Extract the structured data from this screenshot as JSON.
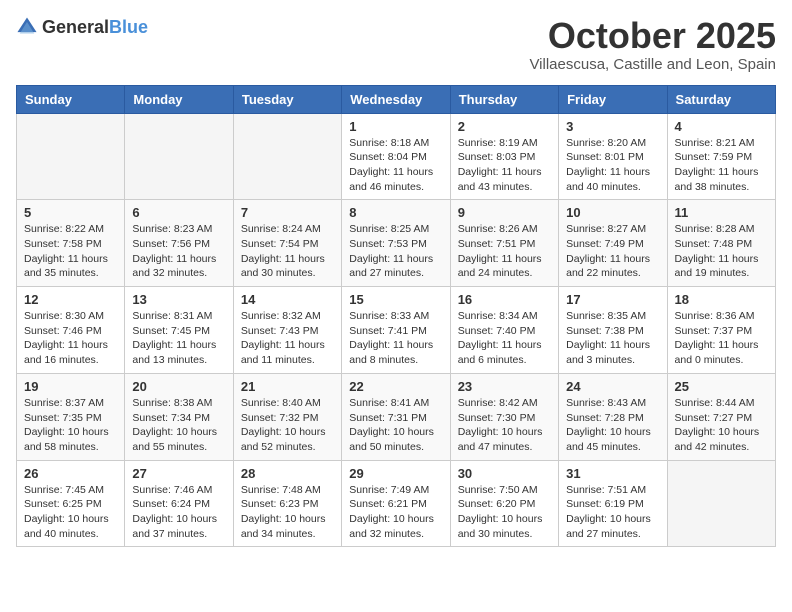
{
  "logo": {
    "general": "General",
    "blue": "Blue"
  },
  "header": {
    "month": "October 2025",
    "location": "Villaescusa, Castille and Leon, Spain"
  },
  "weekdays": [
    "Sunday",
    "Monday",
    "Tuesday",
    "Wednesday",
    "Thursday",
    "Friday",
    "Saturday"
  ],
  "weeks": [
    [
      {
        "day": "",
        "info": ""
      },
      {
        "day": "",
        "info": ""
      },
      {
        "day": "",
        "info": ""
      },
      {
        "day": "1",
        "info": "Sunrise: 8:18 AM\nSunset: 8:04 PM\nDaylight: 11 hours\nand 46 minutes."
      },
      {
        "day": "2",
        "info": "Sunrise: 8:19 AM\nSunset: 8:03 PM\nDaylight: 11 hours\nand 43 minutes."
      },
      {
        "day": "3",
        "info": "Sunrise: 8:20 AM\nSunset: 8:01 PM\nDaylight: 11 hours\nand 40 minutes."
      },
      {
        "day": "4",
        "info": "Sunrise: 8:21 AM\nSunset: 7:59 PM\nDaylight: 11 hours\nand 38 minutes."
      }
    ],
    [
      {
        "day": "5",
        "info": "Sunrise: 8:22 AM\nSunset: 7:58 PM\nDaylight: 11 hours\nand 35 minutes."
      },
      {
        "day": "6",
        "info": "Sunrise: 8:23 AM\nSunset: 7:56 PM\nDaylight: 11 hours\nand 32 minutes."
      },
      {
        "day": "7",
        "info": "Sunrise: 8:24 AM\nSunset: 7:54 PM\nDaylight: 11 hours\nand 30 minutes."
      },
      {
        "day": "8",
        "info": "Sunrise: 8:25 AM\nSunset: 7:53 PM\nDaylight: 11 hours\nand 27 minutes."
      },
      {
        "day": "9",
        "info": "Sunrise: 8:26 AM\nSunset: 7:51 PM\nDaylight: 11 hours\nand 24 minutes."
      },
      {
        "day": "10",
        "info": "Sunrise: 8:27 AM\nSunset: 7:49 PM\nDaylight: 11 hours\nand 22 minutes."
      },
      {
        "day": "11",
        "info": "Sunrise: 8:28 AM\nSunset: 7:48 PM\nDaylight: 11 hours\nand 19 minutes."
      }
    ],
    [
      {
        "day": "12",
        "info": "Sunrise: 8:30 AM\nSunset: 7:46 PM\nDaylight: 11 hours\nand 16 minutes."
      },
      {
        "day": "13",
        "info": "Sunrise: 8:31 AM\nSunset: 7:45 PM\nDaylight: 11 hours\nand 13 minutes."
      },
      {
        "day": "14",
        "info": "Sunrise: 8:32 AM\nSunset: 7:43 PM\nDaylight: 11 hours\nand 11 minutes."
      },
      {
        "day": "15",
        "info": "Sunrise: 8:33 AM\nSunset: 7:41 PM\nDaylight: 11 hours\nand 8 minutes."
      },
      {
        "day": "16",
        "info": "Sunrise: 8:34 AM\nSunset: 7:40 PM\nDaylight: 11 hours\nand 6 minutes."
      },
      {
        "day": "17",
        "info": "Sunrise: 8:35 AM\nSunset: 7:38 PM\nDaylight: 11 hours\nand 3 minutes."
      },
      {
        "day": "18",
        "info": "Sunrise: 8:36 AM\nSunset: 7:37 PM\nDaylight: 11 hours\nand 0 minutes."
      }
    ],
    [
      {
        "day": "19",
        "info": "Sunrise: 8:37 AM\nSunset: 7:35 PM\nDaylight: 10 hours\nand 58 minutes."
      },
      {
        "day": "20",
        "info": "Sunrise: 8:38 AM\nSunset: 7:34 PM\nDaylight: 10 hours\nand 55 minutes."
      },
      {
        "day": "21",
        "info": "Sunrise: 8:40 AM\nSunset: 7:32 PM\nDaylight: 10 hours\nand 52 minutes."
      },
      {
        "day": "22",
        "info": "Sunrise: 8:41 AM\nSunset: 7:31 PM\nDaylight: 10 hours\nand 50 minutes."
      },
      {
        "day": "23",
        "info": "Sunrise: 8:42 AM\nSunset: 7:30 PM\nDaylight: 10 hours\nand 47 minutes."
      },
      {
        "day": "24",
        "info": "Sunrise: 8:43 AM\nSunset: 7:28 PM\nDaylight: 10 hours\nand 45 minutes."
      },
      {
        "day": "25",
        "info": "Sunrise: 8:44 AM\nSunset: 7:27 PM\nDaylight: 10 hours\nand 42 minutes."
      }
    ],
    [
      {
        "day": "26",
        "info": "Sunrise: 7:45 AM\nSunset: 6:25 PM\nDaylight: 10 hours\nand 40 minutes."
      },
      {
        "day": "27",
        "info": "Sunrise: 7:46 AM\nSunset: 6:24 PM\nDaylight: 10 hours\nand 37 minutes."
      },
      {
        "day": "28",
        "info": "Sunrise: 7:48 AM\nSunset: 6:23 PM\nDaylight: 10 hours\nand 34 minutes."
      },
      {
        "day": "29",
        "info": "Sunrise: 7:49 AM\nSunset: 6:21 PM\nDaylight: 10 hours\nand 32 minutes."
      },
      {
        "day": "30",
        "info": "Sunrise: 7:50 AM\nSunset: 6:20 PM\nDaylight: 10 hours\nand 30 minutes."
      },
      {
        "day": "31",
        "info": "Sunrise: 7:51 AM\nSunset: 6:19 PM\nDaylight: 10 hours\nand 27 minutes."
      },
      {
        "day": "",
        "info": ""
      }
    ]
  ]
}
